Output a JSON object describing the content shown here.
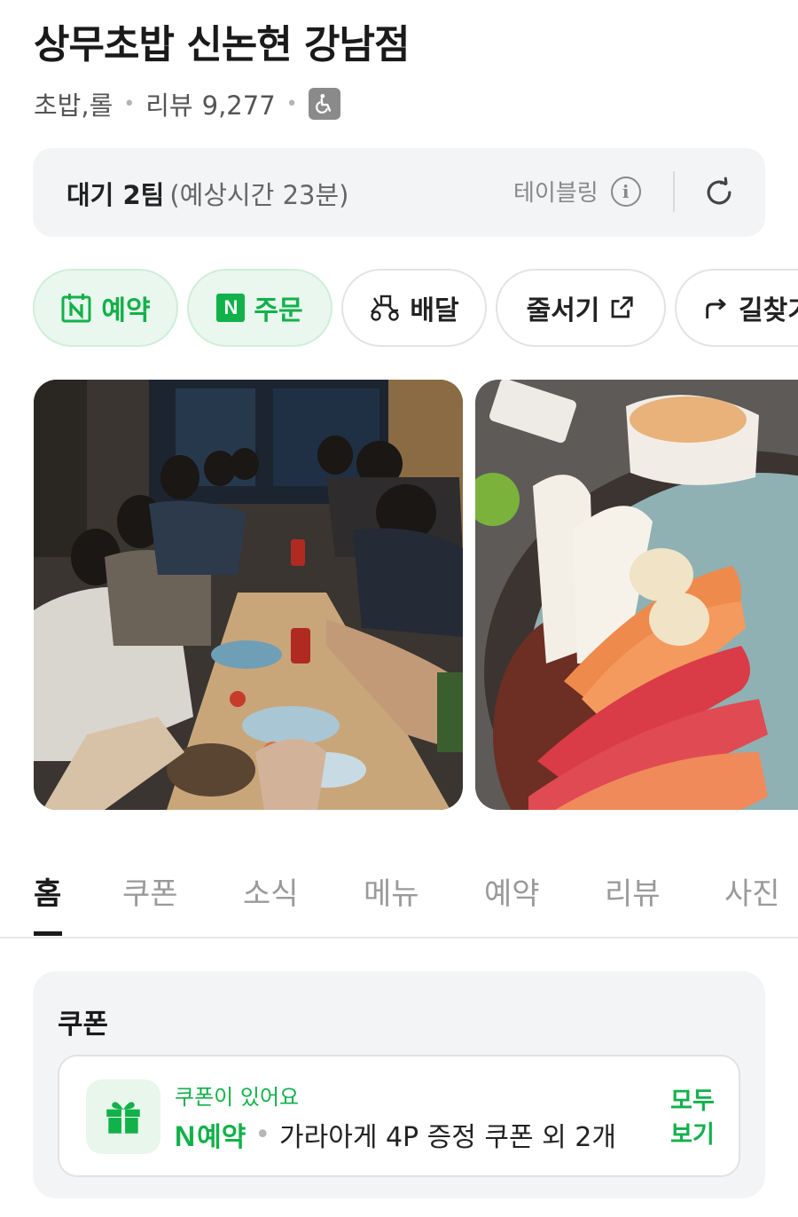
{
  "place": {
    "name": "상무초밥 신논현 강남점",
    "category": "초밥,롤",
    "review_label": "리뷰",
    "review_count": "9,277",
    "accessibility_icon": "wheelchair-icon"
  },
  "wait": {
    "status": "대기 2팀",
    "estimate": "(예상시간 23분)",
    "provider": "테이블링",
    "info_icon": "info-icon",
    "refresh_icon": "refresh-icon"
  },
  "actions": [
    {
      "label": "예약",
      "icon": "naver-calendar-icon"
    },
    {
      "label": "주문",
      "icon": "naver-n-icon"
    },
    {
      "label": "배달",
      "icon": "delivery-scooter-icon"
    },
    {
      "label": "줄서기",
      "icon": "external-link-icon"
    },
    {
      "label": "길찾기",
      "icon": "directions-arrow-icon"
    }
  ],
  "photos": [
    {
      "subject": "group-dinner-photo"
    },
    {
      "subject": "sushi-plate-photo"
    }
  ],
  "tabs": [
    {
      "label": "홈",
      "active": true
    },
    {
      "label": "쿠폰",
      "active": false
    },
    {
      "label": "소식",
      "active": false
    },
    {
      "label": "메뉴",
      "active": false
    },
    {
      "label": "예약",
      "active": false
    },
    {
      "label": "리뷰",
      "active": false
    },
    {
      "label": "사진",
      "active": false
    }
  ],
  "coupon": {
    "heading": "쿠폰",
    "notice": "쿠폰이 있어요",
    "brand_n": "N",
    "brand_label": "예약",
    "description": "가라아게 4P 증정 쿠폰 외 2개",
    "see_all_line1": "모두",
    "see_all_line2": "보기",
    "icon": "gift-icon"
  },
  "colors": {
    "accent_green": "#12b14a",
    "card_bg": "#f3f4f6",
    "chip_green_bg": "#eaf7ee"
  }
}
